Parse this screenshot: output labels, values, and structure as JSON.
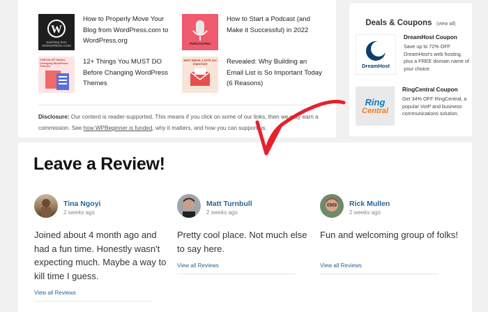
{
  "posts": [
    {
      "title": "How to Properly Move Your Blog from WordPress.com to WordPress.org",
      "thumb_icon": "wordpress-logo-icon",
      "thumb_caption": "Switching from WORDPRESS.COM"
    },
    {
      "title": "How to Start a Podcast (and Make it Successful) in 2022",
      "thumb_icon": "microphone-icon",
      "thumb_caption": "PODCASTING"
    },
    {
      "title": "12+ Things You MUST DO Before Changing WordPress Themes",
      "thumb_icon": "checklist-icon",
      "thumb_caption": "CHECKLIST Before Changing WordPress Themes"
    },
    {
      "title": "Revealed: Why Building an Email List is So Important Today (6 Reasons)",
      "thumb_icon": "email-icon",
      "thumb_caption": "WHY EMAIL LISTS are important"
    }
  ],
  "disclosure": {
    "label": "Disclosure:",
    "text_before": " Our content is reader-supported. This means if you click on some of our links, then we may earn a commission. See ",
    "link": "how WPBeginner is funded",
    "text_after": ", why it matters, and how you can support us."
  },
  "deals": {
    "title": "Deals & Coupons",
    "view_all": "(view all)",
    "coupons": [
      {
        "title": "DreamHost Coupon",
        "desc": "Save up to 72% OFF DreamHost's web hosting, plus a FREE domain name of your choice.",
        "logo_text": "DreamHost",
        "logo_icon": "dreamhost-moon-icon"
      },
      {
        "title": "RingCentral Coupon",
        "desc": "Get 34% OFF RingCentral, a popular VoIP and business communications solution.",
        "logo_line1": "Ring",
        "logo_line2": "Central"
      }
    ]
  },
  "reviews": {
    "heading": "Leave a Review!",
    "items": [
      {
        "name": "Tina Ngoyi",
        "time": "2 weeks ago",
        "text": "Joined about 4 month ago and had a fun time. Honestly wasn't expecting much. Maybe a way to kill time I guess.",
        "link": "View all Reviews"
      },
      {
        "name": "Matt Turnbull",
        "time": "2 weeks ago",
        "text": "Pretty cool place. Not much else to say here.",
        "link": "View all Reviews"
      },
      {
        "name": "Rick Mullen",
        "time": "2 weeks ago",
        "text": "Fun and welcoming group of folks!",
        "link": "View all Reviews"
      }
    ]
  },
  "colors": {
    "link_blue": "#2a6496",
    "arrow_red": "#e8202a",
    "dreamhost_blue": "#0d3d71",
    "ringcentral_orange": "#f47a20"
  }
}
